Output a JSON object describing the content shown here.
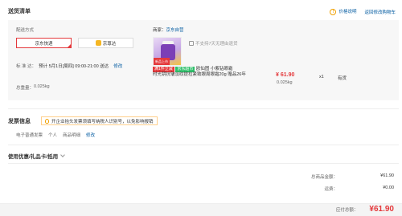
{
  "header": {
    "title": "送货清单",
    "price_info_label": "价格说明",
    "back_to_cart_label": "返回修改购物车"
  },
  "shipping": {
    "method_label": "配送方式",
    "options": [
      {
        "label": "京东快递",
        "selected": true
      },
      {
        "label": "京尊达",
        "selected": false
      }
    ],
    "standard_label": "标  准  达：",
    "schedule": "预计 5月1日[周四] 09:00-21:00 送达",
    "modify_label": "修改",
    "weight_label": "总重量：",
    "weight": "0.025kg"
  },
  "product": {
    "merchant_label": "商家：",
    "merchant": "京东自营",
    "no_return_note": "不支持7天无理由退货",
    "thumb_tag": "新品上市",
    "promo_badge": "满1件立减",
    "self_badge": "京东超市",
    "name_line1": "欧仙图 小紫钻眼霜",
    "name_line2": "时光钥抗皱淡纹提拉紧致眼周眼霜20g 赠品26年",
    "price": "¥ 61.90",
    "weight": "0.025kg",
    "quantity": "x1",
    "stock": "有货"
  },
  "invoice": {
    "title": "发票信息",
    "tip": "开企业抬头发票须填写纳税人识别号，以免影响报销",
    "type": "电子普通发票",
    "person": "个人",
    "detail": "商品明细",
    "modify_label": "修改"
  },
  "coupon": {
    "title": "使用优惠/礼品卡/抵用"
  },
  "summary": {
    "goods_total_label": "总商品金额：",
    "goods_total": "¥61.90",
    "shipping_label": "运费：",
    "shipping": "¥0.00",
    "payable_label": "应付总额：",
    "payable": "¥61.90"
  },
  "colors": {
    "accent_red": "#e4393c",
    "link_blue": "#005aa0",
    "warn_orange": "#f0a000"
  }
}
